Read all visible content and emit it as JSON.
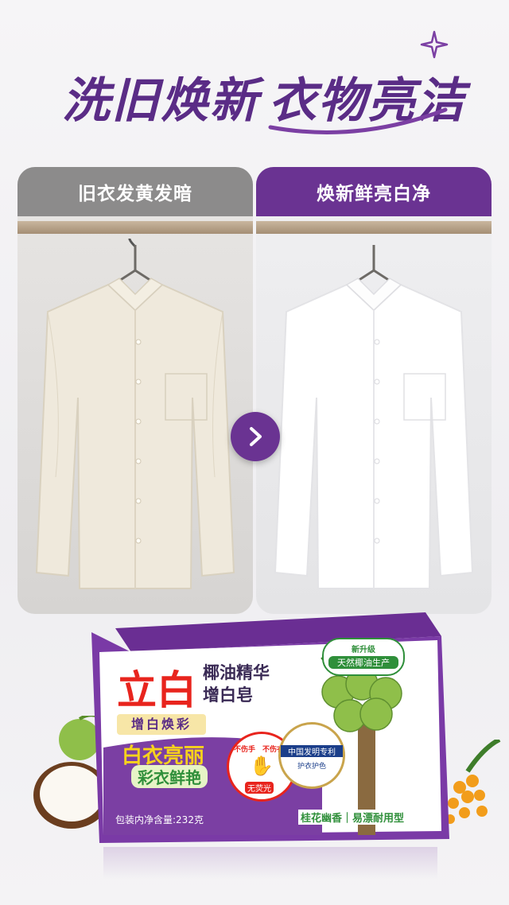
{
  "headline": {
    "part1": "洗旧焕新",
    "part2": "衣物亮洁"
  },
  "panels": {
    "before_label": "旧衣发黄发暗",
    "after_label": "焕新鲜亮白净"
  },
  "arrow_icon": "chevron-right-icon",
  "product": {
    "brand": "立白",
    "name_line1": "椰油精华",
    "name_line2": "增白皂",
    "upgrade_badge_line1": "新升级",
    "upgrade_badge_line2": "天然椰油生产",
    "feature_tag": "增白焕彩",
    "slogan1": "白衣亮丽",
    "slogan2": "彩衣鲜艳",
    "hand_seal_top": "不伤手",
    "hand_seal_top2": "不伤衣",
    "hand_seal_bottom": "无荧光",
    "patent_seal": "中国发明专利",
    "patent_seal_sub": "护衣护色",
    "scent_line": "桂花幽香｜易漂耐用型",
    "weight_line": "包装内净含量:232克"
  },
  "colors": {
    "purple": "#6a3392",
    "dark_purple": "#5a2c86",
    "gray": "#8c8b8b",
    "green": "#2f8f3a",
    "yellow": "#f7d21c"
  }
}
